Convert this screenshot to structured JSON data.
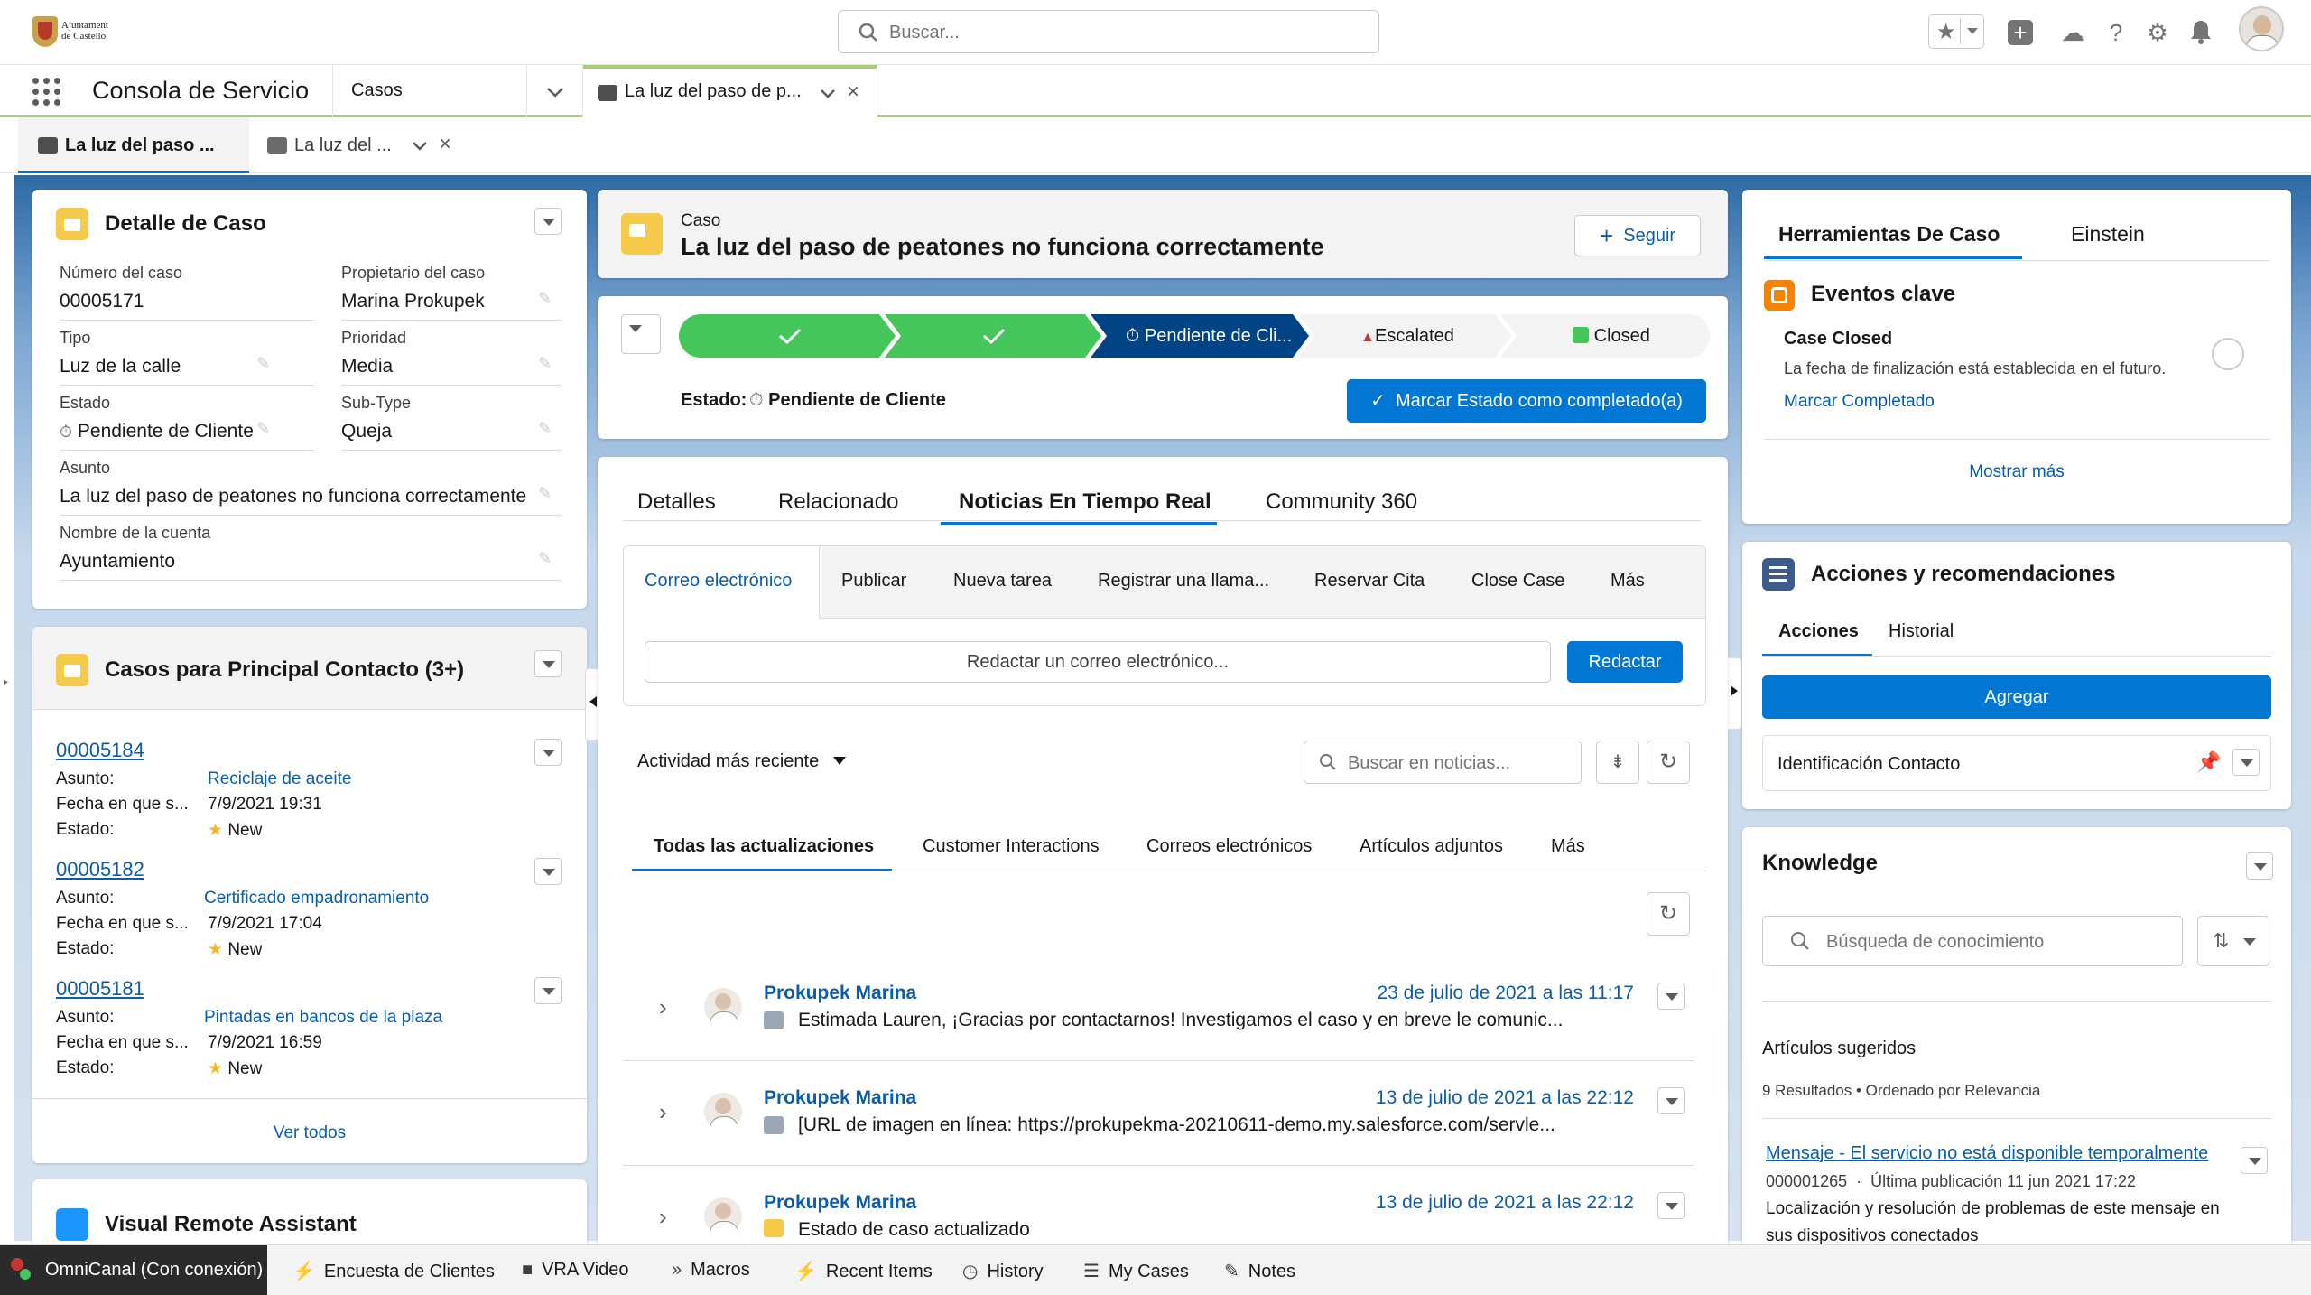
{
  "header": {
    "logo_text_1": "Ajuntament",
    "logo_text_2": "de Castelló",
    "search_placeholder": "Buscar..."
  },
  "nav": {
    "app_name": "Consola de Servicio",
    "object_tab": "Casos",
    "record_tab": "La luz del paso de p..."
  },
  "subtabs": [
    "La luz del paso ...",
    "La luz del ..."
  ],
  "case_detail": {
    "title": "Detalle de Caso",
    "fields": {
      "case_number_label": "Número del caso",
      "case_number": "00005171",
      "owner_label": "Propietario del caso",
      "owner": "Marina Prokupek",
      "type_label": "Tipo",
      "type": "Luz de la calle",
      "priority_label": "Prioridad",
      "priority": "Media",
      "status_label": "Estado",
      "status": "Pendiente de Cliente",
      "subtype_label": "Sub-Type",
      "subtype": "Queja",
      "subject_label": "Asunto",
      "subject": "La luz del paso de peatones no funciona correctamente",
      "account_label": "Nombre de la cuenta",
      "account": "Ayuntamiento"
    }
  },
  "related_cases": {
    "title": "Casos para Principal Contacto (3+)",
    "labels": {
      "subject": "Asunto:",
      "date": "Fecha en que s...",
      "status": "Estado:"
    },
    "items": [
      {
        "number": "00005184",
        "subject": "Reciclaje de aceite",
        "date": "7/9/2021 19:31",
        "status": "New"
      },
      {
        "number": "00005182",
        "subject": "Certificado empadronamiento",
        "date": "7/9/2021 17:04",
        "status": "New"
      },
      {
        "number": "00005181",
        "subject": "Pintadas en bancos de la plaza",
        "date": "7/9/2021 16:59",
        "status": "New"
      }
    ],
    "view_all": "Ver todos"
  },
  "vra": {
    "title": "Visual Remote Assistant"
  },
  "case_header": {
    "object": "Caso",
    "title": "La luz del paso de peatones no funciona correctamente",
    "follow": "Seguir"
  },
  "path": {
    "steps": [
      "",
      "",
      "Pendiente de Cli...",
      "Escalated",
      "Closed"
    ],
    "status_label": "Estado:",
    "status_value": "Pendiente de Cliente",
    "complete_button": "Marcar Estado como completado(a)"
  },
  "main_tabs": [
    "Detalles",
    "Relacionado",
    "Noticias En Tiempo Real",
    "Community 360"
  ],
  "publisher": {
    "actions": [
      "Correo electrónico",
      "Publicar",
      "Nueva tarea",
      "Registrar una llama...",
      "Reservar Cita",
      "Close Case",
      "Más"
    ],
    "compose_placeholder": "Redactar un correo electrónico...",
    "compose_button": "Redactar"
  },
  "feed": {
    "sort": "Actividad más reciente",
    "search_placeholder": "Buscar en noticias...",
    "filters": [
      "Todas las actualizaciones",
      "Customer Interactions",
      "Correos electrónicos",
      "Artículos adjuntos",
      "Más"
    ],
    "items": [
      {
        "name": "Prokupek Marina",
        "date": "23 de julio de 2021 a las 11:17",
        "body": "Estimada Lauren, ¡Gracias por contactarnos! Investigamos el caso y en breve le comunic..."
      },
      {
        "name": "Prokupek Marina",
        "date": "13 de julio de 2021 a las 22:12",
        "body": "[URL de imagen en línea: https://prokupekma-20210611-demo.my.salesforce.com/servle..."
      },
      {
        "name": "Prokupek Marina",
        "date": "13 de julio de 2021 a las 22:12",
        "body": "Estado de caso actualizado"
      }
    ]
  },
  "tools": {
    "tabs": [
      "Herramientas De Caso",
      "Einstein"
    ],
    "key_events_title": "Eventos clave",
    "event_title": "Case Closed",
    "event_desc": "La fecha de finalización está establecida en el futuro.",
    "event_link": "Marcar Completado",
    "show_more": "Mostrar más"
  },
  "actions_card": {
    "title": "Acciones y recomendaciones",
    "tabs": [
      "Acciones",
      "Historial"
    ],
    "add_button": "Agregar",
    "item": "Identificación Contacto"
  },
  "knowledge": {
    "title": "Knowledge",
    "search_placeholder": "Búsqueda de conocimiento",
    "suggested_label": "Artículos sugeridos",
    "results": "9 Resultados",
    "sort": "Ordenado por Relevancia",
    "article_title": "Mensaje - El servicio no está disponible temporalmente",
    "article_number": "000001265",
    "article_published": "Última publicación  11 jun 2021 17:22",
    "article_summary_1": "Localización y resolución de problemas de este mensaje en",
    "article_summary_2": "sus dispositivos conectados"
  },
  "footer": {
    "omni": "OmniCanal (Con conexión)",
    "items": [
      "Encuesta de Clientes",
      "VRA Video",
      "Macros",
      "Recent Items",
      "History",
      "My Cases",
      "Notes"
    ]
  },
  "colors": {
    "brand": "#0176d3",
    "path_complete": "#45c65a",
    "path_current": "#014486",
    "link": "#0b5cab"
  }
}
